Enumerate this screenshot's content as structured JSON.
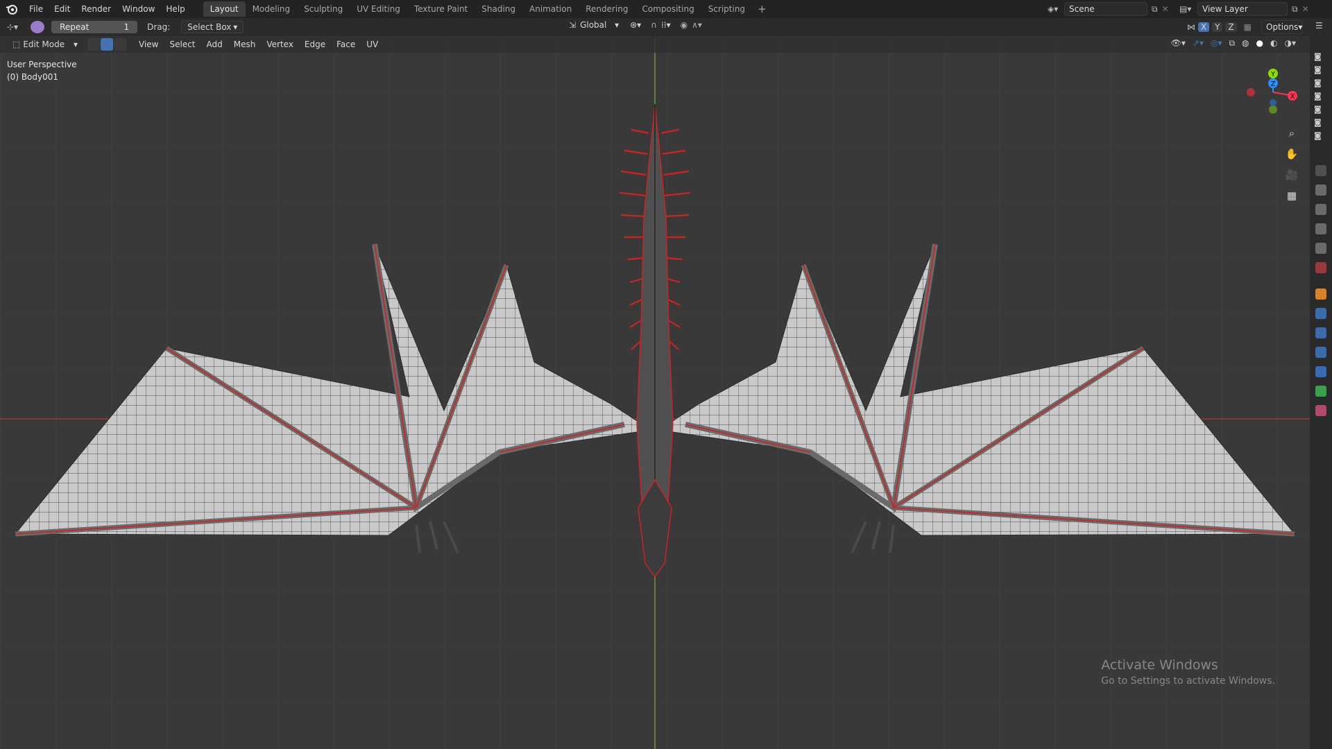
{
  "menus": [
    "File",
    "Edit",
    "Render",
    "Window",
    "Help"
  ],
  "workspaces": [
    "Layout",
    "Modeling",
    "Sculpting",
    "UV Editing",
    "Texture Paint",
    "Shading",
    "Animation",
    "Rendering",
    "Compositing",
    "Scripting"
  ],
  "workspace_active": "Layout",
  "workspace_add": "+",
  "scene": "Scene",
  "view_layer": "View Layer",
  "toolbar": {
    "repeat_label": "Repeat",
    "repeat_count": "1",
    "drag_label": "Drag:",
    "drag_value": "Select Box",
    "transform_orientation": "Global",
    "options_label": "Options",
    "axis_x": "X",
    "axis_y": "Y",
    "axis_z": "Z"
  },
  "viewport_header": {
    "mode": "Edit Mode",
    "menus": [
      "View",
      "Select",
      "Add",
      "Mesh",
      "Vertex",
      "Edge",
      "Face",
      "UV"
    ]
  },
  "viewport": {
    "view_name": "User Perspective",
    "object_name": "(0) Body001"
  },
  "gizmo": {
    "x": "X",
    "y": "Y",
    "z": "Z"
  },
  "watermark": {
    "title": "Activate Windows",
    "subtitle": "Go to Settings to activate Windows."
  },
  "colors": {
    "accent": "#4772b3",
    "x_axis": "#ff3352",
    "y_axis": "#8bdc00",
    "z_axis": "#2890ff",
    "seam": "#d42020"
  }
}
